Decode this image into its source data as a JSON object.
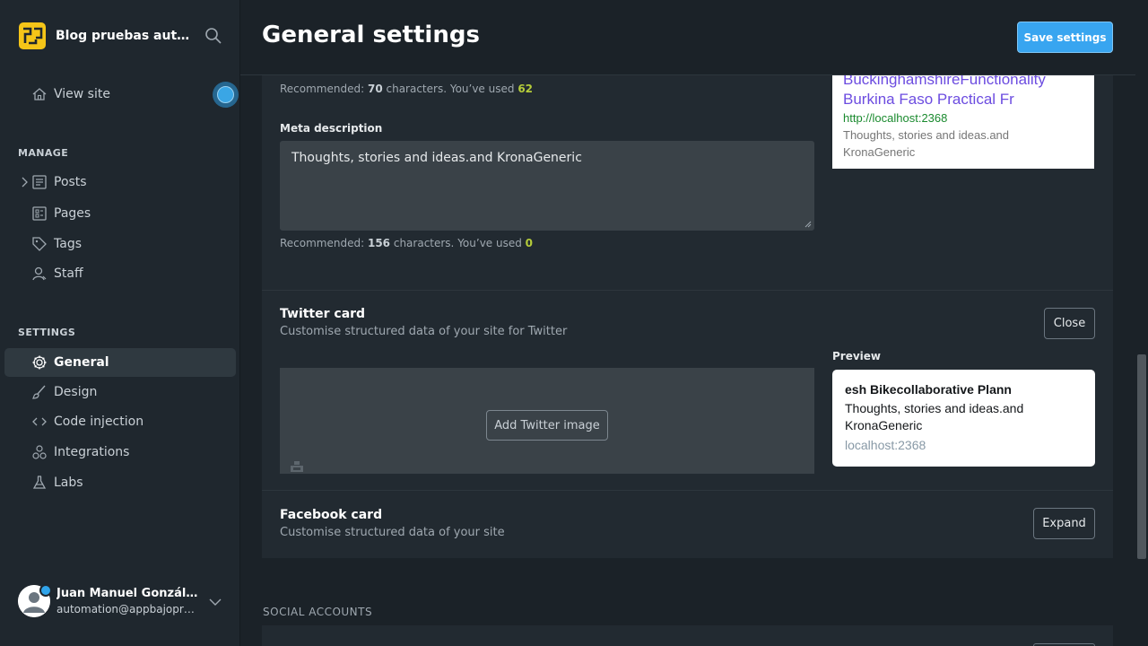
{
  "brand": {
    "title": "Blog pruebas automatizadas",
    "search_icon": "search-icon",
    "logo_color": "#f5c518"
  },
  "nav": {
    "view_site": "View site",
    "manage_label": "MANAGE",
    "manage_items": [
      "Posts",
      "Pages",
      "Tags",
      "Staff"
    ],
    "settings_label": "SETTINGS",
    "settings_items": [
      "General",
      "Design",
      "Code injection",
      "Integrations",
      "Labs"
    ],
    "active": "General"
  },
  "user": {
    "name": "Juan Manuel González",
    "email": "automation@appbajopruebas.com"
  },
  "header": {
    "title": "General settings",
    "save_label": "Save settings"
  },
  "meta": {
    "title_hint": {
      "prefix": "Recommended: ",
      "recommended": "70",
      "middle": " characters. You’ve used ",
      "used": "62"
    },
    "description_label": "Meta description",
    "description_value": "Thoughts, stories and ideas.and KronaGeneric",
    "description_hint": {
      "prefix": "Recommended: ",
      "recommended": "156",
      "middle": " characters. You’ve used ",
      "used": "0"
    },
    "preview": {
      "title_line1": "BuckinghamshireFunctionality",
      "title_line2": "Burkina Faso Practical Fr",
      "url": "http://localhost:2368",
      "desc_line1": "Thoughts, stories and ideas.and",
      "desc_line2": "KronaGeneric"
    }
  },
  "twitter": {
    "title": "Twitter card",
    "subtitle": "Customise structured data of your site for Twitter",
    "close_label": "Close",
    "add_image_label": "Add Twitter image",
    "preview_label": "Preview",
    "card": {
      "title": "esh Bikecollaborative Plann",
      "desc": "Thoughts, stories and ideas.and KronaGeneric",
      "domain": "localhost:2368"
    }
  },
  "facebook": {
    "title": "Facebook card",
    "subtitle": "Customise structured data of your site",
    "expand_label": "Expand"
  },
  "social": {
    "label": "SOCIAL ACCOUNTS"
  },
  "colors": {
    "accent": "#38a5f0",
    "used_count": "#b5cc3a",
    "seo_title": "#6c4ce0",
    "seo_url": "#1a8a2e"
  }
}
